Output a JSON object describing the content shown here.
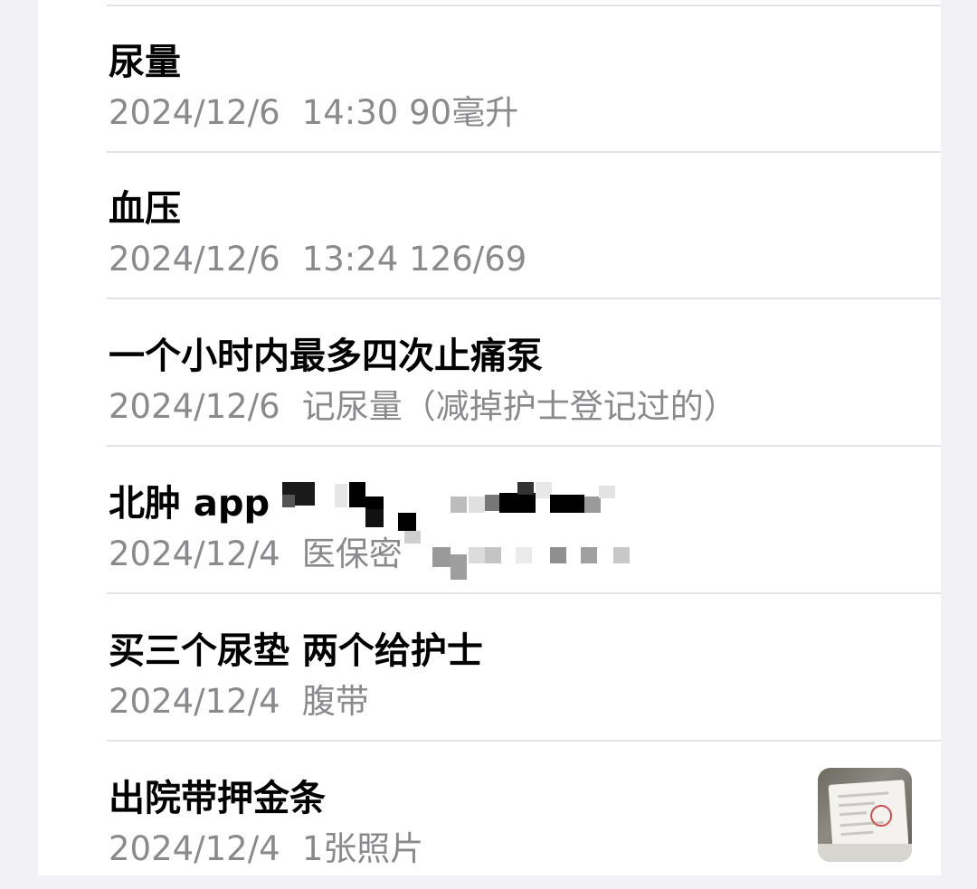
{
  "notes": [
    {
      "title": "尿量",
      "date": "2024/12/6",
      "preview": "14:30 90毫升",
      "has_thumbnail": false
    },
    {
      "title": "血压",
      "date": "2024/12/6",
      "preview": "13:24 126/69",
      "has_thumbnail": false
    },
    {
      "title": "一个小时内最多四次止痛泵",
      "date": "2024/12/6",
      "preview": "记尿量（减掉护士登记过的）",
      "has_thumbnail": false
    },
    {
      "title": "北肿 app",
      "date": "2024/12/4",
      "preview": "医保密",
      "has_thumbnail": false,
      "redacted": true
    },
    {
      "title": "买三个尿垫 两个给护士",
      "date": "2024/12/4",
      "preview": "腹带",
      "has_thumbnail": false
    },
    {
      "title": "出院带押金条",
      "date": "2024/12/4",
      "preview": "1张照片",
      "has_thumbnail": true,
      "thumbnail_icon": "photo-thumbnail-icon"
    }
  ],
  "colors": {
    "background": "#f2f2f6",
    "card": "#ffffff",
    "title": "#000000",
    "meta": "#8a8a8e",
    "separator": "#e3e3e6"
  }
}
